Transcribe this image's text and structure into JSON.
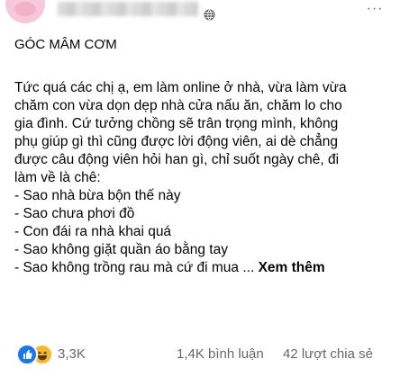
{
  "post": {
    "header": {
      "audience_icon": "globe-icon",
      "more_label": "···"
    },
    "title": "GÓC MÂM CƠM",
    "body_lines": [
      "Tức quá các chị ạ, em làm online ở nhà, vừa làm vừa",
      "chăm con vừa dọn dẹp nhà cửa nấu ăn, chăm lo cho",
      "gia đình. Cứ tưởng chồng sẽ trân trọng mình, không",
      "phụ giúp gì thì cũng được lời động viên, ai dè chẳng",
      "được câu động viên hỏi han gì, chỉ suốt ngày chê, đi",
      "làm về là chê:"
    ],
    "list_items": [
      "- Sao nhà bừa bộn thế này",
      "- Sao chưa phơi đồ",
      "- Con đái ra nhà khai quá",
      "- Sao không giặt quần áo bằng tay"
    ],
    "last_line": "- Sao không trồng rau mà cứ đi mua ...",
    "see_more": "Xem thêm",
    "footer": {
      "reaction_icons": [
        "like-icon",
        "haha-icon"
      ],
      "reaction_count": "3,3K",
      "comment_count": "1,4K bình luận",
      "share_count": "42 lượt chia sẻ"
    }
  },
  "colors": {
    "text_primary": "#050505",
    "text_secondary": "#65676b",
    "like_blue": "#1877f2",
    "haha_yellow": "#f7b928",
    "avatar_pink": "#f7c8d9"
  }
}
